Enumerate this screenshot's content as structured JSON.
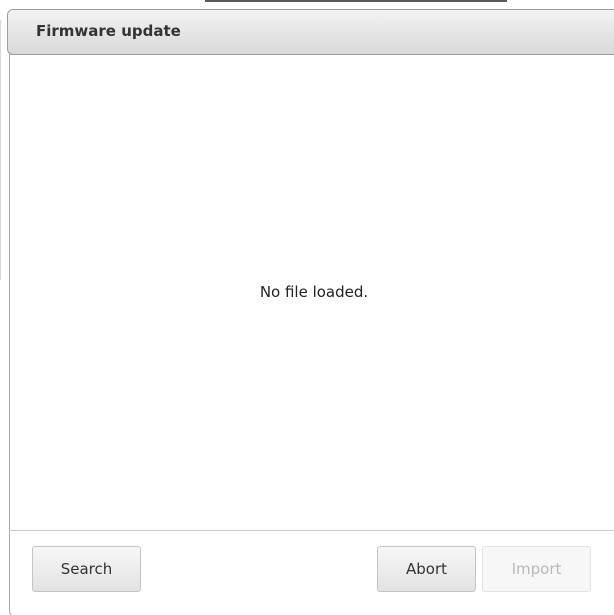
{
  "dialog": {
    "title": "Firmware update",
    "message": "No file loaded."
  },
  "buttons": {
    "search": "Search",
    "abort": "Abort",
    "import": "Import"
  }
}
